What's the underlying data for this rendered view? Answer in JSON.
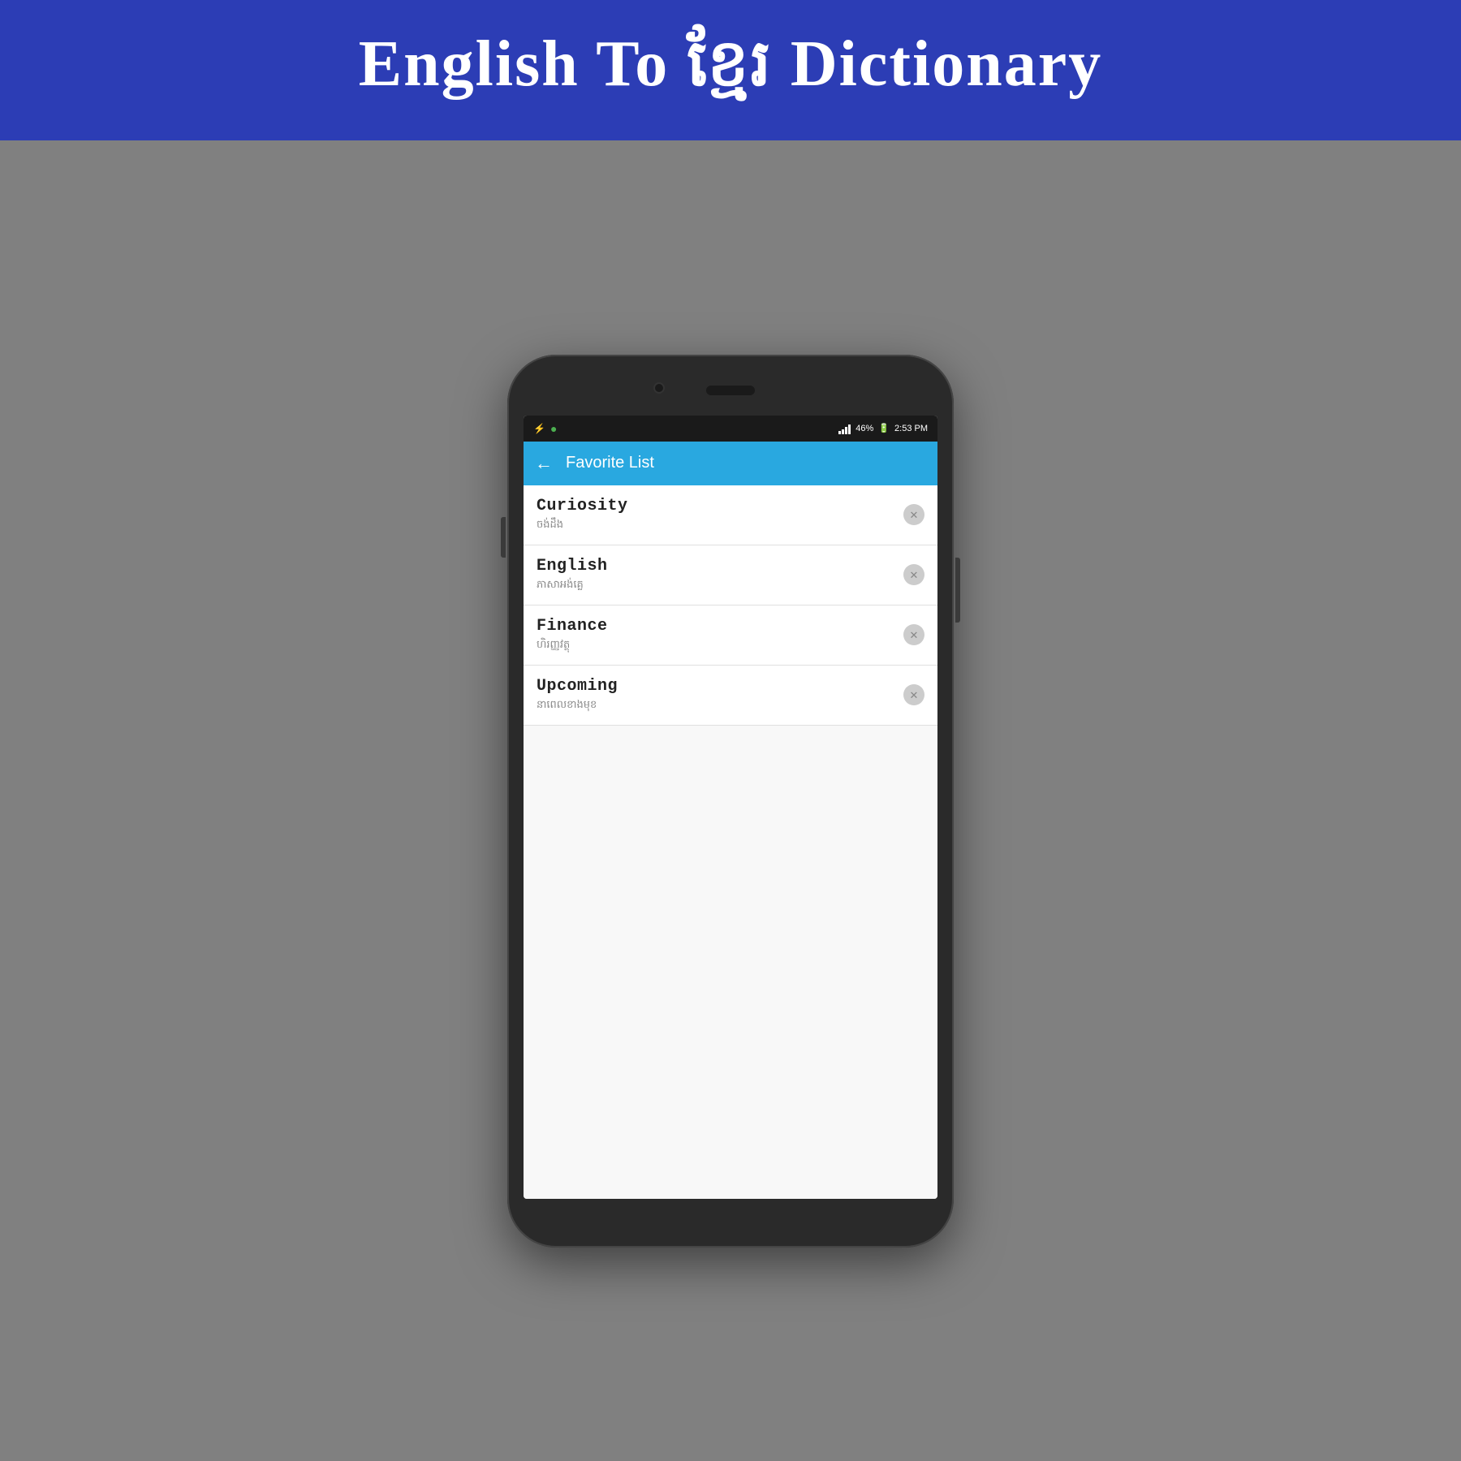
{
  "banner": {
    "title_part1": "English To ",
    "title_khmer": "ខ្មែរ",
    "title_part2": " Dictionary"
  },
  "status_bar": {
    "battery": "46%",
    "time": "2:53 PM"
  },
  "app_bar": {
    "title": "Favorite List",
    "back_label": "←"
  },
  "list_items": [
    {
      "english": "Curiosity",
      "khmer": "ចង់ដឹង"
    },
    {
      "english": "English",
      "khmer": "ភាសាអង់គ្លេ"
    },
    {
      "english": "Finance",
      "khmer": "ហិរញ្ញវត្ថុ"
    },
    {
      "english": "Upcoming",
      "khmer": "នាពេលខាងមុខ"
    }
  ]
}
